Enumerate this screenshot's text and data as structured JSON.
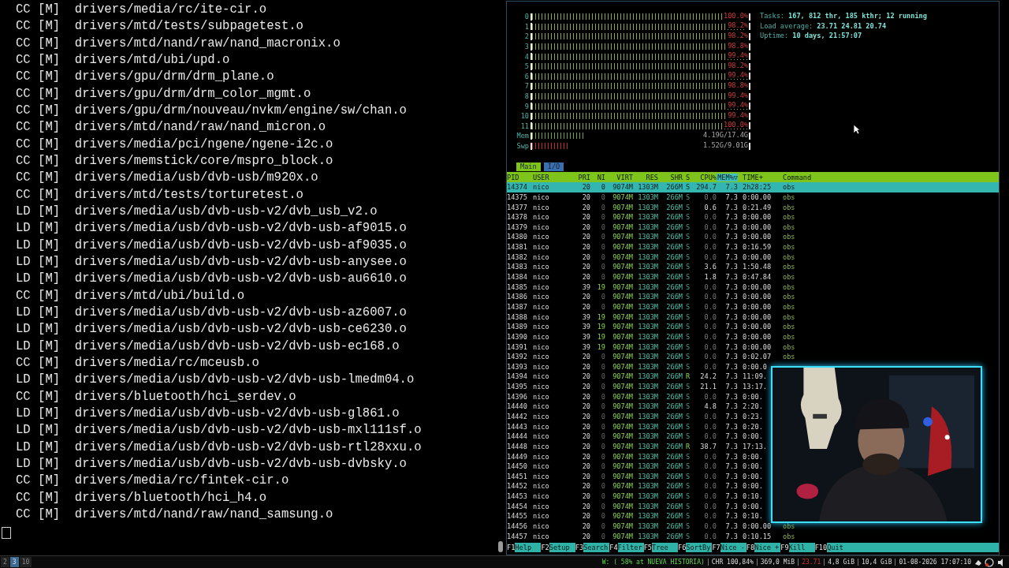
{
  "terminal": {
    "lines": [
      "CC [M]  drivers/media/rc/ite-cir.o",
      "CC [M]  drivers/mtd/tests/subpagetest.o",
      "CC [M]  drivers/mtd/nand/raw/nand_macronix.o",
      "CC [M]  drivers/mtd/ubi/upd.o",
      "CC [M]  drivers/gpu/drm/drm_plane.o",
      "CC [M]  drivers/gpu/drm/drm_color_mgmt.o",
      "CC [M]  drivers/gpu/drm/nouveau/nvkm/engine/sw/chan.o",
      "CC [M]  drivers/mtd/nand/raw/nand_micron.o",
      "CC [M]  drivers/media/pci/ngene/ngene-i2c.o",
      "CC [M]  drivers/memstick/core/mspro_block.o",
      "CC [M]  drivers/media/usb/dvb-usb/m920x.o",
      "CC [M]  drivers/mtd/tests/torturetest.o",
      "LD [M]  drivers/media/usb/dvb-usb-v2/dvb_usb_v2.o",
      "LD [M]  drivers/media/usb/dvb-usb-v2/dvb-usb-af9015.o",
      "LD [M]  drivers/media/usb/dvb-usb-v2/dvb-usb-af9035.o",
      "LD [M]  drivers/media/usb/dvb-usb-v2/dvb-usb-anysee.o",
      "LD [M]  drivers/media/usb/dvb-usb-v2/dvb-usb-au6610.o",
      "CC [M]  drivers/mtd/ubi/build.o",
      "LD [M]  drivers/media/usb/dvb-usb-v2/dvb-usb-az6007.o",
      "LD [M]  drivers/media/usb/dvb-usb-v2/dvb-usb-ce6230.o",
      "LD [M]  drivers/media/usb/dvb-usb-v2/dvb-usb-ec168.o",
      "CC [M]  drivers/media/rc/mceusb.o",
      "LD [M]  drivers/media/usb/dvb-usb-v2/dvb-usb-lmedm04.o",
      "CC [M]  drivers/bluetooth/hci_serdev.o",
      "LD [M]  drivers/media/usb/dvb-usb-v2/dvb-usb-gl861.o",
      "LD [M]  drivers/media/usb/dvb-usb-v2/dvb-usb-mxl111sf.o",
      "LD [M]  drivers/media/usb/dvb-usb-v2/dvb-usb-rtl28xxu.o",
      "LD [M]  drivers/media/usb/dvb-usb-v2/dvb-usb-dvbsky.o",
      "CC [M]  drivers/media/rc/fintek-cir.o",
      "CC [M]  drivers/bluetooth/hci_h4.o",
      "CC [M]  drivers/mtd/nand/raw/nand_samsung.o"
    ]
  },
  "htop": {
    "cpus": [
      {
        "label": "0",
        "level": 1.0,
        "reading": "100.0%"
      },
      {
        "label": "1",
        "level": 0.982,
        "reading": "98.2%"
      },
      {
        "label": "2",
        "level": 0.982,
        "reading": "98.2%"
      },
      {
        "label": "3",
        "level": 0.988,
        "reading": "98.8%"
      },
      {
        "label": "4",
        "level": 0.994,
        "reading": "99.4%"
      },
      {
        "label": "5",
        "level": 0.982,
        "reading": "98.2%"
      },
      {
        "label": "6",
        "level": 0.994,
        "reading": "99.4%"
      },
      {
        "label": "7",
        "level": 0.988,
        "reading": "98.8%"
      },
      {
        "label": "8",
        "level": 0.994,
        "reading": "99.4%"
      },
      {
        "label": "9",
        "level": 0.994,
        "reading": "99.4%"
      },
      {
        "label": "10",
        "level": 0.994,
        "reading": "99.4%"
      },
      {
        "label": "11",
        "level": 1.0,
        "reading": "100.0%"
      }
    ],
    "memory": [
      {
        "label": "Mem",
        "level": 0.24,
        "reading": "4.19G/17.4G"
      },
      {
        "label": "Swp",
        "level": 0.17,
        "reading": "1.52G/9.01G"
      }
    ],
    "info": [
      {
        "label": "Tasks:",
        "value": "167, 812 thr, 185 kthr; 12 running"
      },
      {
        "label": "Load average:",
        "value": "23.71 24.81 20.74"
      },
      {
        "label": "Uptime:",
        "value": "10 days, 21:57:07"
      }
    ],
    "tabs": [
      {
        "label": "Main",
        "selected": true
      },
      {
        "label": "I/O",
        "selected": false
      }
    ],
    "columns": [
      {
        "label": "PID",
        "sorted": false
      },
      {
        "label": "USER",
        "sorted": false
      },
      {
        "label": "PRI",
        "sorted": false
      },
      {
        "label": "NI",
        "sorted": false
      },
      {
        "label": "VIRT",
        "sorted": false
      },
      {
        "label": "RES",
        "sorted": false
      },
      {
        "label": "SHR",
        "sorted": false
      },
      {
        "label": "S",
        "sorted": false
      },
      {
        "label": "CPU%",
        "sorted": false
      },
      {
        "label": "MEM%▽",
        "sorted": true
      },
      {
        "label": "TIME+",
        "sorted": false
      },
      {
        "label": "Command",
        "sorted": false
      }
    ],
    "rows": [
      {
        "selected": true,
        "cells": [
          "14374",
          "nico",
          "20",
          "0",
          "9074M",
          "1303M",
          "266M",
          "S",
          "294.7",
          "7.3",
          "2h28:25",
          "obs"
        ]
      },
      {
        "selected": false,
        "cells": [
          "14375",
          "nico",
          "20",
          "0",
          "9074M",
          "1303M",
          "266M",
          "S",
          "0.0",
          "7.3",
          "0:00.00",
          "obs"
        ]
      },
      {
        "selected": false,
        "cells": [
          "14377",
          "nico",
          "20",
          "0",
          "9074M",
          "1303M",
          "266M",
          "S",
          "0.6",
          "7.3",
          "0:21.49",
          "obs"
        ]
      },
      {
        "selected": false,
        "cells": [
          "14378",
          "nico",
          "20",
          "0",
          "9074M",
          "1303M",
          "266M",
          "S",
          "0.0",
          "7.3",
          "0:00.00",
          "obs"
        ]
      },
      {
        "selected": false,
        "cells": [
          "14379",
          "nico",
          "20",
          "0",
          "9074M",
          "1303M",
          "266M",
          "S",
          "0.0",
          "7.3",
          "0:00.00",
          "obs"
        ]
      },
      {
        "selected": false,
        "cells": [
          "14380",
          "nico",
          "20",
          "0",
          "9074M",
          "1303M",
          "266M",
          "S",
          "0.0",
          "7.3",
          "0:00.00",
          "obs"
        ]
      },
      {
        "selected": false,
        "cells": [
          "14381",
          "nico",
          "20",
          "0",
          "9074M",
          "1303M",
          "266M",
          "S",
          "0.0",
          "7.3",
          "0:16.59",
          "obs"
        ]
      },
      {
        "selected": false,
        "cells": [
          "14382",
          "nico",
          "20",
          "0",
          "9074M",
          "1303M",
          "266M",
          "S",
          "0.0",
          "7.3",
          "0:00.00",
          "obs"
        ]
      },
      {
        "selected": false,
        "cells": [
          "14383",
          "nico",
          "20",
          "0",
          "9074M",
          "1303M",
          "266M",
          "S",
          "3.6",
          "7.3",
          "1:50.48",
          "obs"
        ]
      },
      {
        "selected": false,
        "cells": [
          "14384",
          "nico",
          "20",
          "0",
          "9074M",
          "1303M",
          "266M",
          "S",
          "1.8",
          "7.3",
          "0:47.84",
          "obs"
        ]
      },
      {
        "selected": false,
        "cells": [
          "14385",
          "nico",
          "39",
          "19",
          "9074M",
          "1303M",
          "266M",
          "S",
          "0.0",
          "7.3",
          "0:00.00",
          "obs"
        ]
      },
      {
        "selected": false,
        "cells": [
          "14386",
          "nico",
          "20",
          "0",
          "9074M",
          "1303M",
          "266M",
          "S",
          "0.0",
          "7.3",
          "0:00.00",
          "obs"
        ]
      },
      {
        "selected": false,
        "cells": [
          "14387",
          "nico",
          "20",
          "0",
          "9074M",
          "1303M",
          "266M",
          "S",
          "0.0",
          "7.3",
          "0:00.00",
          "obs"
        ]
      },
      {
        "selected": false,
        "cells": [
          "14388",
          "nico",
          "39",
          "19",
          "9074M",
          "1303M",
          "266M",
          "S",
          "0.0",
          "7.3",
          "0:00.00",
          "obs"
        ]
      },
      {
        "selected": false,
        "cells": [
          "14389",
          "nico",
          "39",
          "19",
          "9074M",
          "1303M",
          "266M",
          "S",
          "0.0",
          "7.3",
          "0:00.00",
          "obs"
        ]
      },
      {
        "selected": false,
        "cells": [
          "14390",
          "nico",
          "39",
          "19",
          "9074M",
          "1303M",
          "266M",
          "S",
          "0.0",
          "7.3",
          "0:00.00",
          "obs"
        ]
      },
      {
        "selected": false,
        "cells": [
          "14391",
          "nico",
          "39",
          "19",
          "9074M",
          "1303M",
          "266M",
          "S",
          "0.0",
          "7.3",
          "0:00.00",
          "obs"
        ]
      },
      {
        "selected": false,
        "cells": [
          "14392",
          "nico",
          "20",
          "0",
          "9074M",
          "1303M",
          "266M",
          "S",
          "0.0",
          "7.3",
          "0:02.07",
          "obs"
        ]
      },
      {
        "selected": false,
        "cells": [
          "14393",
          "nico",
          "20",
          "0",
          "9074M",
          "1303M",
          "266M",
          "S",
          "0.0",
          "7.3",
          "0:00.0"
        ]
      },
      {
        "selected": false,
        "cells": [
          "14394",
          "nico",
          "20",
          "0",
          "9074M",
          "1303M",
          "266M",
          "R",
          "24.2",
          "7.3",
          "11:09."
        ]
      },
      {
        "selected": false,
        "cells": [
          "14395",
          "nico",
          "20",
          "0",
          "9074M",
          "1303M",
          "266M",
          "S",
          "21.1",
          "7.3",
          "13:17."
        ]
      },
      {
        "selected": false,
        "cells": [
          "14396",
          "nico",
          "20",
          "0",
          "9074M",
          "1303M",
          "266M",
          "S",
          "0.0",
          "7.3",
          "0:00."
        ]
      },
      {
        "selected": false,
        "cells": [
          "14440",
          "nico",
          "20",
          "0",
          "9074M",
          "1303M",
          "266M",
          "S",
          "4.8",
          "7.3",
          "2:20."
        ]
      },
      {
        "selected": false,
        "cells": [
          "14442",
          "nico",
          "20",
          "0",
          "9074M",
          "1303M",
          "266M",
          "S",
          "0.0",
          "7.3",
          "0:23."
        ]
      },
      {
        "selected": false,
        "cells": [
          "14443",
          "nico",
          "20",
          "0",
          "9074M",
          "1303M",
          "266M",
          "S",
          "0.0",
          "7.3",
          "0:20."
        ]
      },
      {
        "selected": false,
        "cells": [
          "14444",
          "nico",
          "20",
          "0",
          "9074M",
          "1303M",
          "266M",
          "S",
          "0.0",
          "7.3",
          "0:00."
        ]
      },
      {
        "selected": false,
        "cells": [
          "14448",
          "nico",
          "20",
          "0",
          "9074M",
          "1303M",
          "266M",
          "R",
          "38.7",
          "7.3",
          "17:13."
        ]
      },
      {
        "selected": false,
        "cells": [
          "14449",
          "nico",
          "20",
          "0",
          "9074M",
          "1303M",
          "266M",
          "S",
          "0.0",
          "7.3",
          "0:00."
        ]
      },
      {
        "selected": false,
        "cells": [
          "14450",
          "nico",
          "20",
          "0",
          "9074M",
          "1303M",
          "266M",
          "S",
          "0.0",
          "7.3",
          "0:00."
        ]
      },
      {
        "selected": false,
        "cells": [
          "14451",
          "nico",
          "20",
          "0",
          "9074M",
          "1303M",
          "266M",
          "S",
          "0.0",
          "7.3",
          "0:00."
        ]
      },
      {
        "selected": false,
        "cells": [
          "14452",
          "nico",
          "20",
          "0",
          "9074M",
          "1303M",
          "266M",
          "S",
          "0.0",
          "7.3",
          "0:00."
        ]
      },
      {
        "selected": false,
        "cells": [
          "14453",
          "nico",
          "20",
          "0",
          "9074M",
          "1303M",
          "266M",
          "S",
          "0.0",
          "7.3",
          "0:10."
        ]
      },
      {
        "selected": false,
        "cells": [
          "14454",
          "nico",
          "20",
          "0",
          "9074M",
          "1303M",
          "266M",
          "S",
          "0.0",
          "7.3",
          "0:00."
        ]
      },
      {
        "selected": false,
        "cells": [
          "14455",
          "nico",
          "20",
          "0",
          "9074M",
          "1303M",
          "266M",
          "S",
          "0.0",
          "7.3",
          "0:10."
        ]
      },
      {
        "selected": false,
        "cells": [
          "14456",
          "nico",
          "20",
          "0",
          "9074M",
          "1303M",
          "266M",
          "S",
          "0.0",
          "7.3",
          "0:00.00",
          "obs"
        ]
      },
      {
        "selected": false,
        "cells": [
          "14457",
          "nico",
          "20",
          "0",
          "9074M",
          "1303M",
          "266M",
          "S",
          "0.0",
          "7.3",
          "0:10.15",
          "obs"
        ]
      }
    ],
    "function_keys": [
      {
        "key": "F1",
        "label": "Help  "
      },
      {
        "key": "F2",
        "label": "Setup "
      },
      {
        "key": "F3",
        "label": "Search"
      },
      {
        "key": "F4",
        "label": "Filter"
      },
      {
        "key": "F5",
        "label": "Tree  "
      },
      {
        "key": "F6",
        "label": "SortBy"
      },
      {
        "key": "F7",
        "label": "Nice -"
      },
      {
        "key": "F8",
        "label": "Nice +"
      },
      {
        "key": "F9",
        "label": "Kill  "
      },
      {
        "key": "F10",
        "label": "Quit"
      }
    ]
  },
  "status_bar": {
    "workspaces": [
      {
        "label": "2",
        "selected": false
      },
      {
        "label": "3",
        "selected": true
      },
      {
        "label": "10",
        "selected": false
      }
    ],
    "items": [
      {
        "kind": "wifi",
        "text": "W: ( 58% at NUEVA HISTORIA)"
      },
      {
        "kind": "plain",
        "text": "CHR 100,84%"
      },
      {
        "kind": "plain",
        "text": "369,0 MiB"
      },
      {
        "kind": "alert",
        "text": "23.71"
      },
      {
        "kind": "plain",
        "text": "4,8 GiB"
      },
      {
        "kind": "plain",
        "text": "10,4 GiB"
      },
      {
        "kind": "plain",
        "text": "01-08-2026 17:07:10"
      }
    ]
  }
}
